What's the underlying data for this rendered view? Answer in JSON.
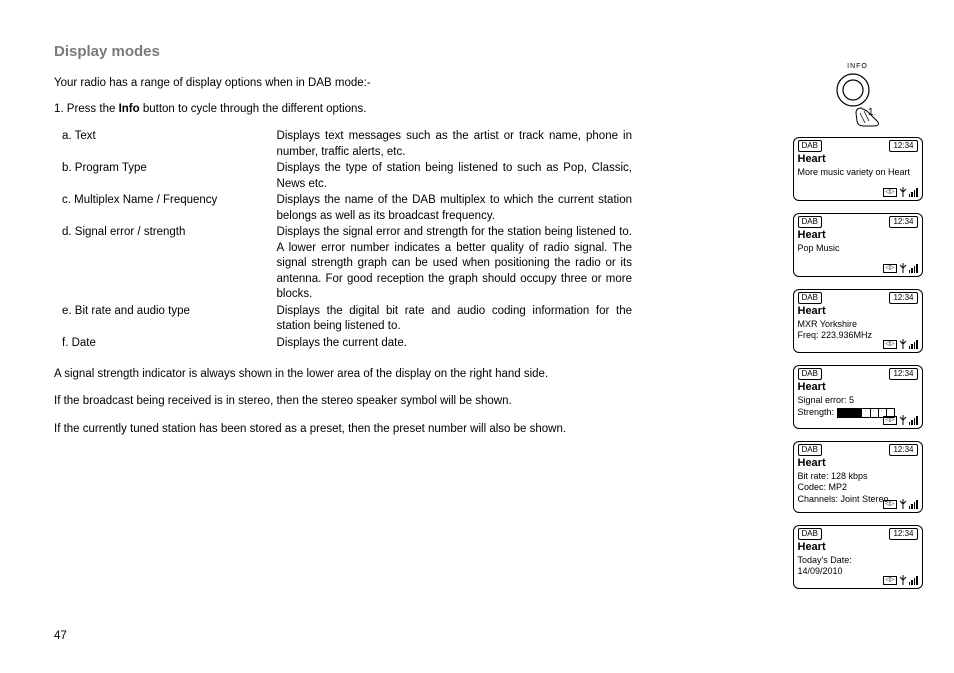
{
  "title": "Display modes",
  "intro": "Your radio has a range of display options when in DAB mode:-",
  "step_pre": "1. Press the ",
  "step_bold": "Info",
  "step_post": " button to cycle through the different options.",
  "options": {
    "a": {
      "label": "a. Text",
      "desc": "Displays text messages such as the artist or track name, phone in number, traffic alerts, etc."
    },
    "b": {
      "label": "b. Program Type",
      "desc": "Displays the type of station being listened to such as Pop, Classic, News etc."
    },
    "c": {
      "label": "c. Multiplex Name / Frequency",
      "desc": "Displays the name of the DAB multiplex to which the current station belongs as well as its broadcast frequency."
    },
    "d": {
      "label": "d. Signal error / strength",
      "desc": "Displays the signal error and strength for the station being listened to. A lower error number indicates a better quality of radio signal. The signal strength graph can be used when positioning the radio or its antenna. For good reception the graph should occupy three or more blocks."
    },
    "e": {
      "label": "e. Bit rate and audio type",
      "desc": "Displays the digital bit rate and audio coding information for the station being listened to."
    },
    "f": {
      "label": "f. Date",
      "desc": "Displays the current date."
    }
  },
  "para1": "A signal strength indicator is always shown in the lower area of the display on the right hand side.",
  "para2": "If the broadcast being received is in stereo, then the stereo speaker symbol will be shown.",
  "para3": "If the currently tuned station has been stored as a preset, then the preset number will also be shown.",
  "page_number": "47",
  "info_button_label": "INFO",
  "finger_number": "1",
  "screens": {
    "mode": "DAB",
    "time": "12:34",
    "station": "Heart",
    "s1_line": "More music variety on Heart",
    "s2_line": "Pop Music",
    "s3_line1": "MXR Yorkshire",
    "s3_line2": "Freq: 223.936MHz",
    "s4_line": "Signal error: 5",
    "s4_strength_label": "Strength:",
    "s5_line1": "Bit rate: 128 kbps",
    "s5_line2": "Codec: MP2",
    "s5_line3": "Channels: Joint Stereo",
    "s6_line1": "Today's Date:",
    "s6_line2": "14/09/2010"
  }
}
